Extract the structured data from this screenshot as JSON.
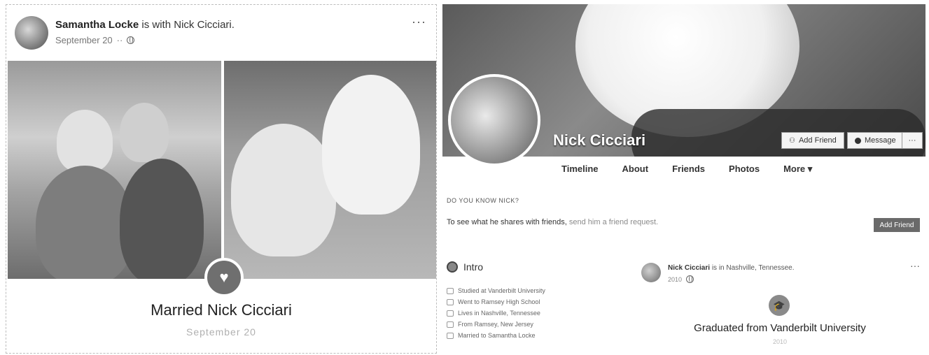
{
  "post": {
    "author": "Samantha Locke",
    "with_text": "is with",
    "tagged": "Nick Cicciari.",
    "date": "September 20",
    "more": "···",
    "event_title": "Married Nick Cicciari",
    "event_date": "September 20"
  },
  "profile": {
    "name": "Nick Cicciari",
    "add_friend_label": "Add Friend",
    "message_label": "Message",
    "more_label": "···",
    "tabs": [
      "Timeline",
      "About",
      "Friends",
      "Photos",
      "More ▾"
    ],
    "know_label": "DO YOU KNOW NICK?",
    "shares_bold": "To see what he shares with friends,",
    "shares_link": "send him a friend request.",
    "add_friend_btn2": "Add Friend",
    "intro_title": "Intro",
    "intro_items": [
      "Studied at Vanderbilt University",
      "Went to Ramsey High School",
      "Lives in Nashville, Tennessee",
      "From Ramsey, New Jersey",
      "Married to Samantha Locke"
    ],
    "feed": {
      "author": "Nick Cicciari",
      "location": "is in Nashville, Tennessee.",
      "date": "2010",
      "more": "···",
      "event_title": "Graduated from Vanderbilt University",
      "event_sub": "2010"
    }
  }
}
